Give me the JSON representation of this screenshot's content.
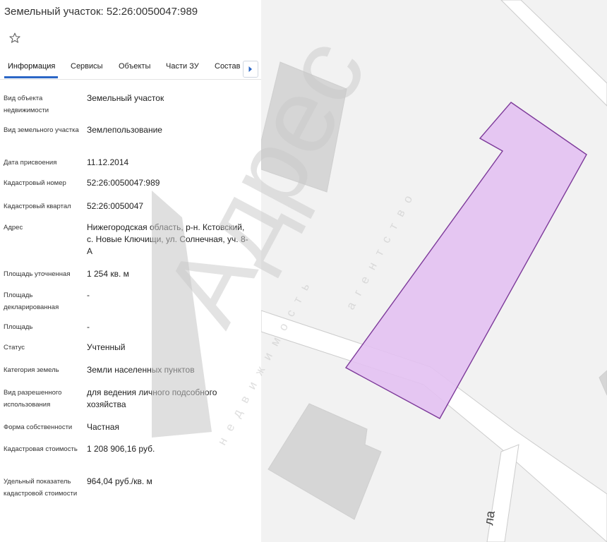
{
  "header": {
    "title": "Земельный участок: 52:26:0050047:989"
  },
  "tabs": [
    {
      "label": "Информация",
      "active": true
    },
    {
      "label": "Сервисы",
      "active": false
    },
    {
      "label": "Объекты",
      "active": false
    },
    {
      "label": "Части ЗУ",
      "active": false
    },
    {
      "label": "Состав",
      "active": false
    }
  ],
  "info_rows": [
    {
      "label": "Вид объекта недвижимости",
      "value": "Земельный участок"
    },
    {
      "label": "Вид земельного участка",
      "value": "Землепользование"
    },
    {
      "label": "Дата присвоения",
      "value": "11.12.2014"
    },
    {
      "label": "Кадастровый номер",
      "value": "52:26:0050047:989"
    },
    {
      "label": "Кадастровый квартал",
      "value": "52:26:0050047"
    },
    {
      "label": "Адрес",
      "value": "Нижегородская область, р-н. Кстовский, с. Новые Ключищи, ул. Солнечная, уч. 8-А"
    },
    {
      "label": "Площадь уточненная",
      "value": "1 254 кв. м"
    },
    {
      "label": "Площадь декларированная",
      "value": "-"
    },
    {
      "label": "Площадь",
      "value": "-"
    },
    {
      "label": "Статус",
      "value": "Учтенный"
    },
    {
      "label": "Категория земель",
      "value": "Земли населенных пунктов"
    },
    {
      "label": "Вид разрешенного использования",
      "value": "для ведения личного подсобного хозяйства"
    },
    {
      "label": "Форма собственности",
      "value": "Частная"
    },
    {
      "label": "Кадастровая стоимость",
      "value": "1 208 906,16 руб."
    },
    {
      "label": "Удельный показатель кадастровой стоимости",
      "value": "964,04 руб./кв. м"
    }
  ],
  "map": {
    "street_label_fragment": "ла",
    "parcel_fill": "#e3c1f2",
    "parcel_stroke": "#7d3a9a"
  },
  "watermark": {
    "logo_text": "Адрес",
    "tagline": "недвижимость",
    "tagline_right": "агентство"
  }
}
